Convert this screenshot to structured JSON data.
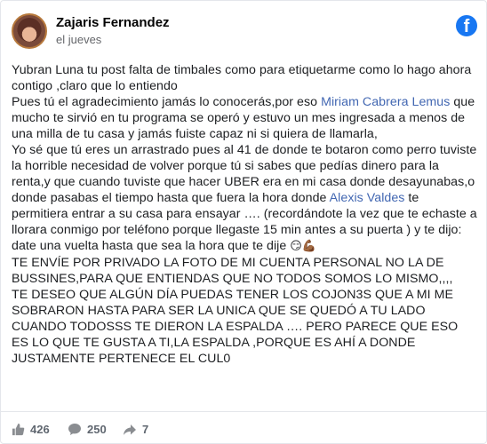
{
  "post": {
    "author": "Zajaris Fernandez",
    "time": "el jueves",
    "paragraphs": [
      {
        "segments": [
          {
            "text": "Yubran Luna tu post falta de timbales como para etiquetarme como lo hago ahora contigo ,claro que lo entiendo"
          }
        ]
      },
      {
        "segments": [
          {
            "text": "Pues tú el agradecimiento jamás lo conocerás,por eso "
          },
          {
            "text": "Miriam Cabrera Lemus",
            "tag": true
          },
          {
            "text": " que mucho te sirvió en tu programa se operó y estuvo un mes ingresada a menos de una milla de tu casa y jamás fuiste capaz ni si quiera de llamarla,"
          }
        ]
      },
      {
        "segments": [
          {
            "text": "Yo sé que tú eres un arrastrado pues al 41 de donde te botaron como perro tuviste la horrible necesidad de volver porque tú si sabes que pedías dinero para la renta,y que cuando tuviste que hacer UBER era en mi casa donde desayunabas,o donde pasabas el tiempo hasta que fuera la hora donde "
          },
          {
            "text": "Alexis Valdes",
            "tag": true
          },
          {
            "text": " te permitiera entrar a su casa para ensayar …. (recordándote la vez que te echaste a llorara conmigo por teléfono porque llegaste 15 min antes a su puerta ) y te dijo: date una vuelta hasta que sea la hora que te dije "
          },
          {
            "text": "😏💪🏾",
            "emoji": true
          }
        ]
      },
      {
        "segments": [
          {
            "text": "TE ENVÍE POR PRIVADO LA FOTO DE MI CUENTA PERSONAL NO LA DE BUSSINES,PARA QUE ENTIENDAS QUE NO TODOS SOMOS LO MISMO,,,,"
          }
        ]
      },
      {
        "segments": [
          {
            "text": "TE DESEO QUE ALGÚN DÍA PUEDAS TENER LOS COJON3S QUE A MI ME SOBRARON HASTA PARA SER LA UNICA QUE SE QUEDÓ A TU LADO CUANDO TODOSSS TE DIERON LA ESPALDA …. PERO PARECE QUE ESO ES LO QUE TE GUSTA A TI,LA ESPALDA ,PORQUE ES AHÍ A DONDE JUSTAMENTE PERTENECE EL CUL0"
          }
        ]
      }
    ]
  },
  "stats": {
    "likes": "426",
    "comments": "250",
    "shares": "7"
  },
  "colors": {
    "facebook_blue": "#1877f2",
    "tag_link": "#4267b2",
    "meta_gray": "#65676b"
  },
  "icons": [
    "facebook-logo-icon",
    "like-icon",
    "comment-icon",
    "share-icon"
  ]
}
